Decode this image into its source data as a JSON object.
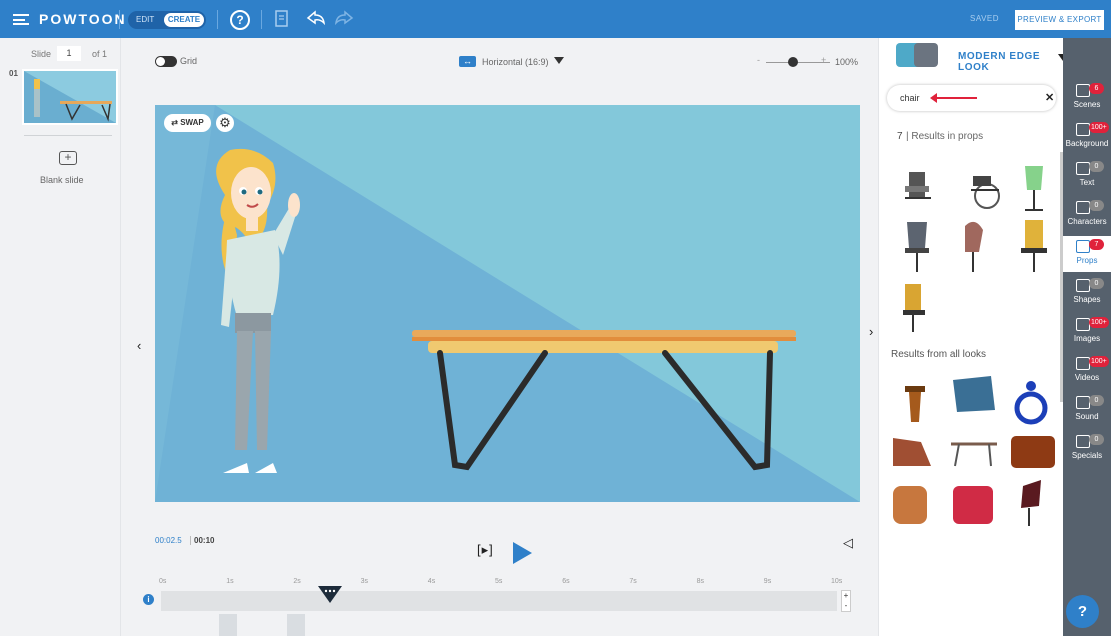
{
  "topbar": {
    "logo": "POWTOON",
    "mode_edit": "EDIT",
    "mode_create": "CREATE",
    "help": "?",
    "saved": "SAVED",
    "export": "PREVIEW & EXPORT"
  },
  "left": {
    "slide_label": "Slide",
    "slide_num": "1",
    "slide_of": "of 1",
    "slide_index": "01",
    "blank_icon": "+",
    "blank_label": "Blank slide"
  },
  "canvas": {
    "grid_label": "Grid",
    "orientation_label": "Horizontal (16:9)",
    "zoom_minus": "-",
    "zoom_plus": "+",
    "zoom_label": "100%",
    "zoom_level": 1.0,
    "swap_label": "SWAP",
    "prev": "‹",
    "next": "›"
  },
  "timeline": {
    "current": "00:02.5",
    "total": "00:10",
    "step": "[▸]",
    "ticks": [
      "0s",
      "1s",
      "2s",
      "3s",
      "4s",
      "5s",
      "6s",
      "7s",
      "8s",
      "9s",
      "10s"
    ],
    "info": "i",
    "zoom_in": "+",
    "zoom_out": "-",
    "playhead_position": 0.25
  },
  "right": {
    "style_name": "MODERN EDGE LOOK",
    "search_value": "chair",
    "clear": "✕",
    "count": "7",
    "results_label": "| Results in props",
    "all_looks_label": "Results from all looks"
  },
  "nav": {
    "items": [
      {
        "label": "Scenes",
        "badge": "6"
      },
      {
        "label": "Background",
        "badge": "100+"
      },
      {
        "label": "Text",
        "badge": "0"
      },
      {
        "label": "Characters",
        "badge": "0"
      },
      {
        "label": "Props",
        "badge": "7"
      },
      {
        "label": "Shapes",
        "badge": "0"
      },
      {
        "label": "Images",
        "badge": "100+"
      },
      {
        "label": "Videos",
        "badge": "100+"
      },
      {
        "label": "Sound",
        "badge": "0"
      },
      {
        "label": "Specials",
        "badge": "0"
      }
    ],
    "help": "?"
  },
  "colors": {
    "brand": "#2f80c9",
    "stage": "#83c8da",
    "nav": "#56616d",
    "badge": "#e0223b"
  }
}
